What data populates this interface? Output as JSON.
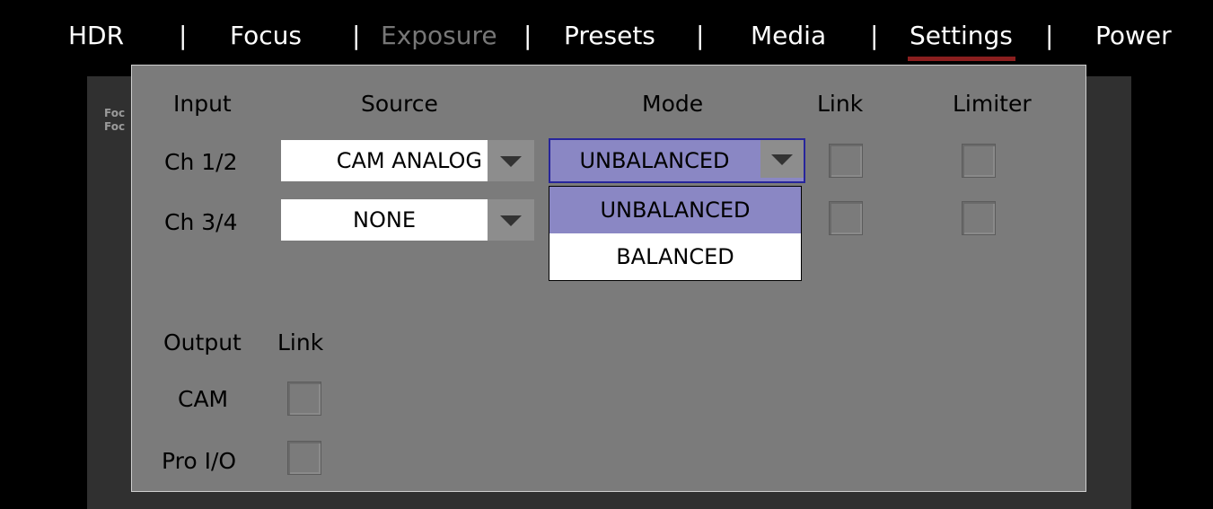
{
  "nav": {
    "items": [
      {
        "label": "HDR",
        "state": "normal"
      },
      {
        "label": "Focus",
        "state": "normal"
      },
      {
        "label": "Exposure",
        "state": "disabled"
      },
      {
        "label": "Presets",
        "state": "normal"
      },
      {
        "label": "Media",
        "state": "normal"
      },
      {
        "label": "Settings",
        "state": "active"
      },
      {
        "label": "Power",
        "state": "normal"
      }
    ],
    "separator": "|",
    "active_underline_color": "#8b1f1f"
  },
  "background": {
    "lines": [
      "Foc",
      "Foc"
    ]
  },
  "dialog": {
    "input_section": {
      "headers": {
        "input": "Input",
        "source": "Source",
        "mode": "Mode",
        "link": "Link",
        "limiter": "Limiter"
      },
      "rows": [
        {
          "label": "Ch 1/2",
          "source": "CAM ANALOG",
          "mode": "UNBALANCED",
          "link_checked": false,
          "limiter_checked": false
        },
        {
          "label": "Ch 3/4",
          "source": "NONE",
          "link_checked": false,
          "limiter_checked": false
        }
      ]
    },
    "mode_dropdown": {
      "options": [
        "UNBALANCED",
        "BALANCED"
      ],
      "highlighted": "UNBALANCED"
    },
    "output_section": {
      "headers": {
        "output": "Output",
        "link": "Link"
      },
      "rows": [
        {
          "label": "CAM",
          "link_checked": false
        },
        {
          "label": "Pro I/O",
          "link_checked": false
        }
      ]
    }
  },
  "colors": {
    "dialog_bg": "#7b7b7b",
    "selection_bg": "#8a87c4",
    "selection_border": "#27259b",
    "arrow_button_bg": "#8d8d8d"
  }
}
